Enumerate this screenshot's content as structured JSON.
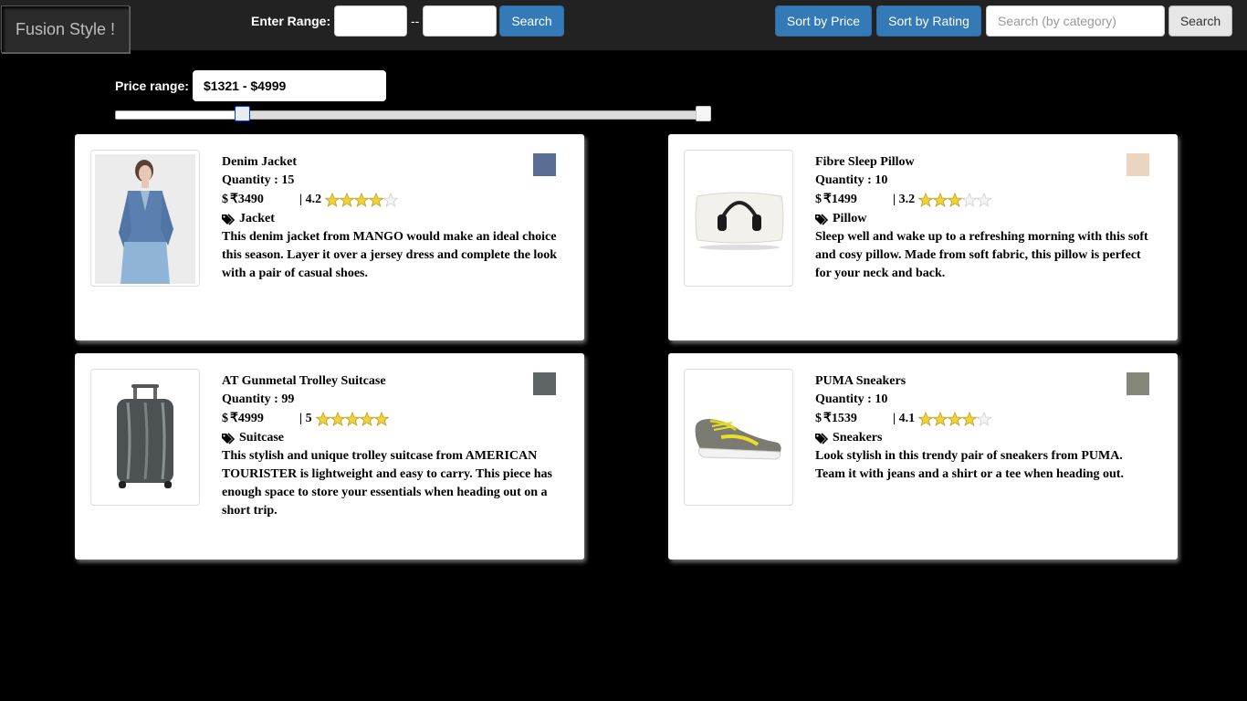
{
  "header": {
    "brand": "Fusion Style !",
    "range_label": "Enter Range:",
    "range_separator": "--",
    "range_search_label": "Search",
    "sort_price_label": "Sort by Price",
    "sort_rating_label": "Sort by Rating",
    "category_placeholder": "Search (by category)",
    "category_search_label": "Search"
  },
  "filter": {
    "price_label": "Price range:",
    "price_value": "$1321 - $4999",
    "slider_low_fraction": 0.214,
    "slider_high_fraction": 1.0
  },
  "products": [
    {
      "name": "Denim Jacket",
      "quantity": "Quantity : 15",
      "currency": "$",
      "price": "₹3490",
      "rating_text": "| 4.2",
      "rating": 4.2,
      "category": "Jacket",
      "description": "This denim jacket from MANGO would make an ideal choice this season. Layer it over a jersey dress and complete the look with a pair of casual shoes.",
      "color": "#5a6e95",
      "icon": "denim-jacket-photo"
    },
    {
      "name": "Fibre Sleep Pillow",
      "quantity": "Quantity : 10",
      "currency": "$",
      "price": "₹1499",
      "rating_text": "| 3.2",
      "rating": 3.2,
      "category": "Pillow",
      "description": "Sleep well and wake up to a refreshing morning with this soft and cosy pillow. Made from soft fabric, this pillow is perfect for your neck and back.",
      "color": "#ead5c1",
      "icon": "pillow-photo"
    },
    {
      "name": "AT Gunmetal Trolley Suitcase",
      "quantity": "Quantity : 99",
      "currency": "$",
      "price": "₹4999",
      "rating_text": "| 5",
      "rating": 5,
      "category": "Suitcase",
      "description": "This stylish and unique trolley suitcase from AMERICAN TOURISTER is lightweight and easy to carry. This piece has enough space to store your essentials when heading out on a short trip.",
      "color": "#5f6566",
      "icon": "suitcase-photo"
    },
    {
      "name": "PUMA Sneakers",
      "quantity": "Quantity : 10",
      "currency": "$",
      "price": "₹1539",
      "rating_text": "| 4.1",
      "rating": 4.1,
      "category": "Sneakers",
      "description": "Look stylish in this trendy pair of sneakers from PUMA. Team it with jeans and a shirt or a tee when heading out.",
      "color": "#858779",
      "icon": "sneakers-photo"
    }
  ]
}
